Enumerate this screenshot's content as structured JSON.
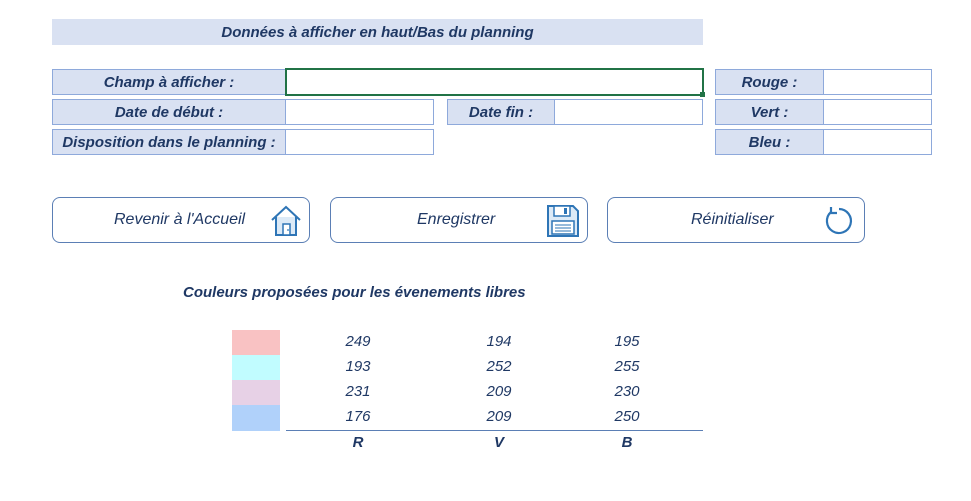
{
  "header": {
    "title": "Données à afficher en haut/Bas du planning"
  },
  "form": {
    "champ_label": "Champ à afficher :",
    "champ_value": "",
    "date_debut_label": "Date de début :",
    "date_debut_value": "",
    "date_fin_label": "Date fin :",
    "date_fin_value": "",
    "disposition_label": "Disposition dans le planning :",
    "disposition_value": ""
  },
  "colors_form": {
    "rouge_label": "Rouge :",
    "rouge_value": "",
    "vert_label": "Vert :",
    "vert_value": "",
    "bleu_label": "Bleu :",
    "bleu_value": ""
  },
  "buttons": {
    "home_label": "Revenir à l'Accueil",
    "home_icon": "house-icon",
    "save_label": "Enregistrer",
    "save_icon": "floppy-disk-icon",
    "reset_label": "Réinitialiser",
    "reset_icon": "refresh-icon"
  },
  "palette": {
    "title": "Couleurs proposées pour les évenements libres",
    "headers": [
      "R",
      "V",
      "B"
    ],
    "rows": [
      {
        "color": "#f9c2c3",
        "r": "249",
        "v": "194",
        "b": "195"
      },
      {
        "color": "#c1fcff",
        "r": "193",
        "v": "252",
        "b": "255"
      },
      {
        "color": "#e7d1e6",
        "r": "231",
        "v": "209",
        "b": "230"
      },
      {
        "color": "#b0d1fa",
        "r": "176",
        "v": "209",
        "b": "250"
      }
    ]
  },
  "theme": {
    "accent_text": "#1f3864",
    "label_bg": "#d9e1f2",
    "border": "#8ea9db",
    "active_border": "#217346"
  }
}
